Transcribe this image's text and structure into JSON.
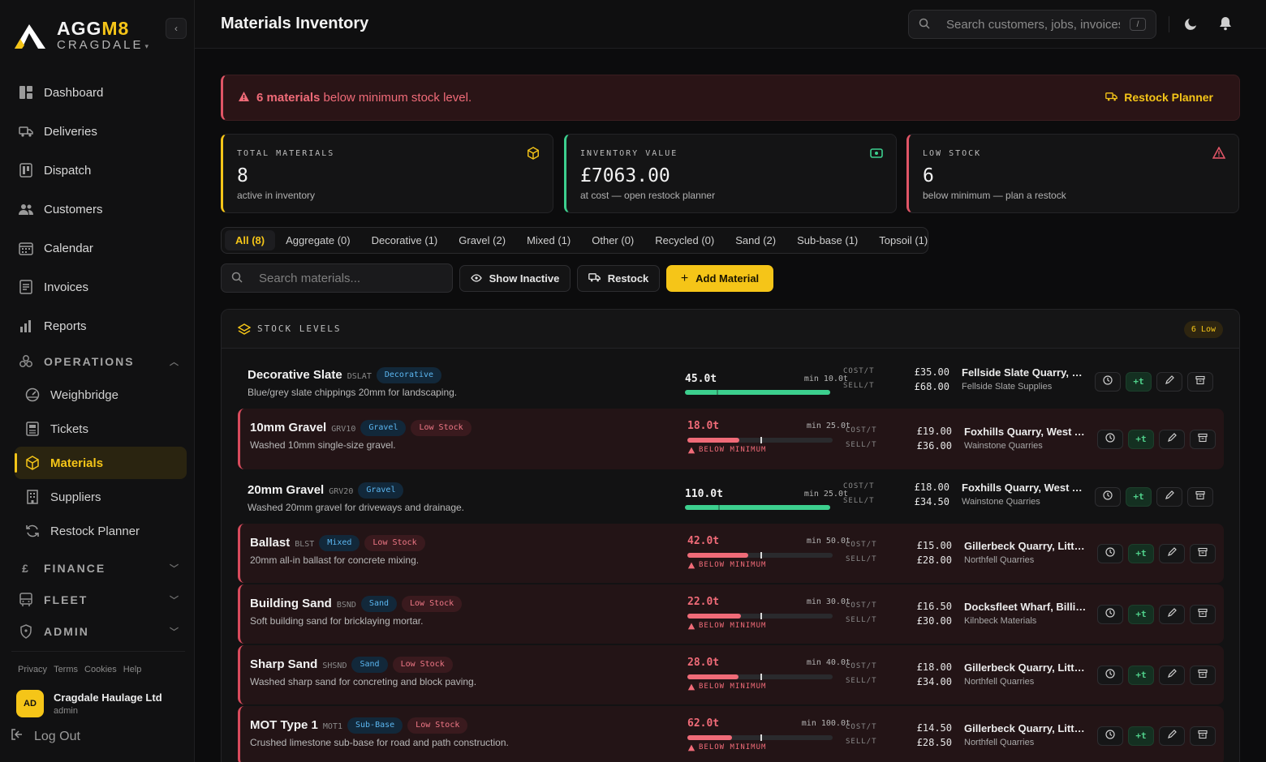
{
  "brand": {
    "name_a": "AGG",
    "name_b": "M8",
    "sub": "CRAGDALE"
  },
  "nav": {
    "items": [
      {
        "label": "Dashboard",
        "icon": "dashboard-icon"
      },
      {
        "label": "Deliveries",
        "icon": "truck-icon"
      },
      {
        "label": "Dispatch",
        "icon": "dispatch-icon"
      },
      {
        "label": "Customers",
        "icon": "users-icon"
      },
      {
        "label": "Calendar",
        "icon": "calendar-icon"
      },
      {
        "label": "Invoices",
        "icon": "invoice-icon"
      },
      {
        "label": "Reports",
        "icon": "chart-icon"
      }
    ],
    "operations": "OPERATIONS",
    "ops_items": [
      {
        "label": "Weighbridge"
      },
      {
        "label": "Tickets"
      },
      {
        "label": "Materials"
      },
      {
        "label": "Suppliers"
      },
      {
        "label": "Restock Planner"
      }
    ],
    "finance": "FINANCE",
    "finance_symbol": "£",
    "fleet": "FLEET",
    "admin": "ADMIN"
  },
  "footer": {
    "links": [
      "Privacy",
      "Terms",
      "Cookies",
      "Help"
    ],
    "avatar": "AD",
    "org": "Cragdale Haulage Ltd",
    "role": "admin",
    "logout": "Log Out"
  },
  "header": {
    "title": "Materials Inventory",
    "search_placeholder": "Search customers, jobs, invoices...",
    "kbd": "/"
  },
  "alert": {
    "count": "6 materials",
    "text": " below minimum stock level.",
    "action": "Restock Planner"
  },
  "stats": [
    {
      "label": "TOTAL MATERIALS",
      "value": "8",
      "sub": "active in inventory"
    },
    {
      "label": "INVENTORY VALUE",
      "value": "£7063.00",
      "sub": "at cost — open restock planner"
    },
    {
      "label": "LOW STOCK",
      "value": "6",
      "sub": "below minimum — plan a restock"
    }
  ],
  "tabs": [
    "All (8)",
    "Aggregate (0)",
    "Decorative (1)",
    "Gravel (2)",
    "Mixed (1)",
    "Other (0)",
    "Recycled (0)",
    "Sand (2)",
    "Sub-base (1)",
    "Topsoil (1)"
  ],
  "toolbar": {
    "search_placeholder": "Search materials...",
    "show_inactive": "Show Inactive",
    "restock": "Restock",
    "add": "Add Material"
  },
  "panel": {
    "title": "STOCK LEVELS",
    "badge": "6 Low"
  },
  "labels": {
    "below": "BELOW MINIMUM",
    "cost": "COST/T",
    "sell": "SELL/T",
    "add_stock": "+t"
  },
  "materials": [
    {
      "name": "Decorative Slate",
      "code": "DSLAT",
      "category": "Decorative",
      "low_label": "",
      "desc": "Blue/grey slate chippings 20mm for landscaping.",
      "qty": "45.0t",
      "min": "min 10.0t",
      "stock_ratio": 1.0,
      "min_ratio": 0.22,
      "cost": "£35.00",
      "sell": "£68.00",
      "supplier": "Fellside Slate Quarry, C...",
      "supplier_sub": "Fellside Slate Supplies"
    },
    {
      "name": "10mm Gravel",
      "code": "GRV10",
      "category": "Gravel",
      "low_label": "Low Stock",
      "desc": "Washed 10mm single-size gravel.",
      "qty": "18.0t",
      "min": "min 25.0t",
      "stock_ratio": 0.36,
      "min_ratio": 0.5,
      "cost": "£19.00",
      "sell": "£36.00",
      "supplier": "Foxhills Quarry, West A...",
      "supplier_sub": "Wainstone Quarries"
    },
    {
      "name": "20mm Gravel",
      "code": "GRV20",
      "category": "Gravel",
      "low_label": "",
      "desc": "Washed 20mm gravel for driveways and drainage.",
      "qty": "110.0t",
      "min": "min 25.0t",
      "stock_ratio": 1.0,
      "min_ratio": 0.23,
      "cost": "£18.00",
      "sell": "£34.50",
      "supplier": "Foxhills Quarry, West A...",
      "supplier_sub": "Wainstone Quarries"
    },
    {
      "name": "Ballast",
      "code": "BLST",
      "category": "Mixed",
      "low_label": "Low Stock",
      "desc": "20mm all-in ballast for concrete mixing.",
      "qty": "42.0t",
      "min": "min 50.0t",
      "stock_ratio": 0.42,
      "min_ratio": 0.5,
      "cost": "£15.00",
      "sell": "£28.00",
      "supplier": "Gillerbeck Quarry, Little ...",
      "supplier_sub": "Northfell Quarries"
    },
    {
      "name": "Building Sand",
      "code": "BSND",
      "category": "Sand",
      "low_label": "Low Stock",
      "desc": "Soft building sand for bricklaying mortar.",
      "qty": "22.0t",
      "min": "min 30.0t",
      "stock_ratio": 0.37,
      "min_ratio": 0.5,
      "cost": "£16.50",
      "sell": "£30.00",
      "supplier": "Docksfleet Wharf, Billin...",
      "supplier_sub": "Kilnbeck Materials"
    },
    {
      "name": "Sharp Sand",
      "code": "SHSND",
      "category": "Sand",
      "low_label": "Low Stock",
      "desc": "Washed sharp sand for concreting and block paving.",
      "qty": "28.0t",
      "min": "min 40.0t",
      "stock_ratio": 0.35,
      "min_ratio": 0.5,
      "cost": "£18.00",
      "sell": "£34.00",
      "supplier": "Gillerbeck Quarry, Little ...",
      "supplier_sub": "Northfell Quarries"
    },
    {
      "name": "MOT Type 1",
      "code": "MOT1",
      "category": "Sub-Base",
      "low_label": "Low Stock",
      "desc": "Crushed limestone sub-base for road and path construction.",
      "qty": "62.0t",
      "min": "min 100.0t",
      "stock_ratio": 0.31,
      "min_ratio": 0.5,
      "cost": "£14.50",
      "sell": "£28.50",
      "supplier": "Gillerbeck Quarry, Little ...",
      "supplier_sub": "Northfell Quarries"
    }
  ],
  "colors": {
    "accent": "#f5c518",
    "danger": "#e05566",
    "ok": "#3ccf8e",
    "info": "#5bb6f0"
  }
}
